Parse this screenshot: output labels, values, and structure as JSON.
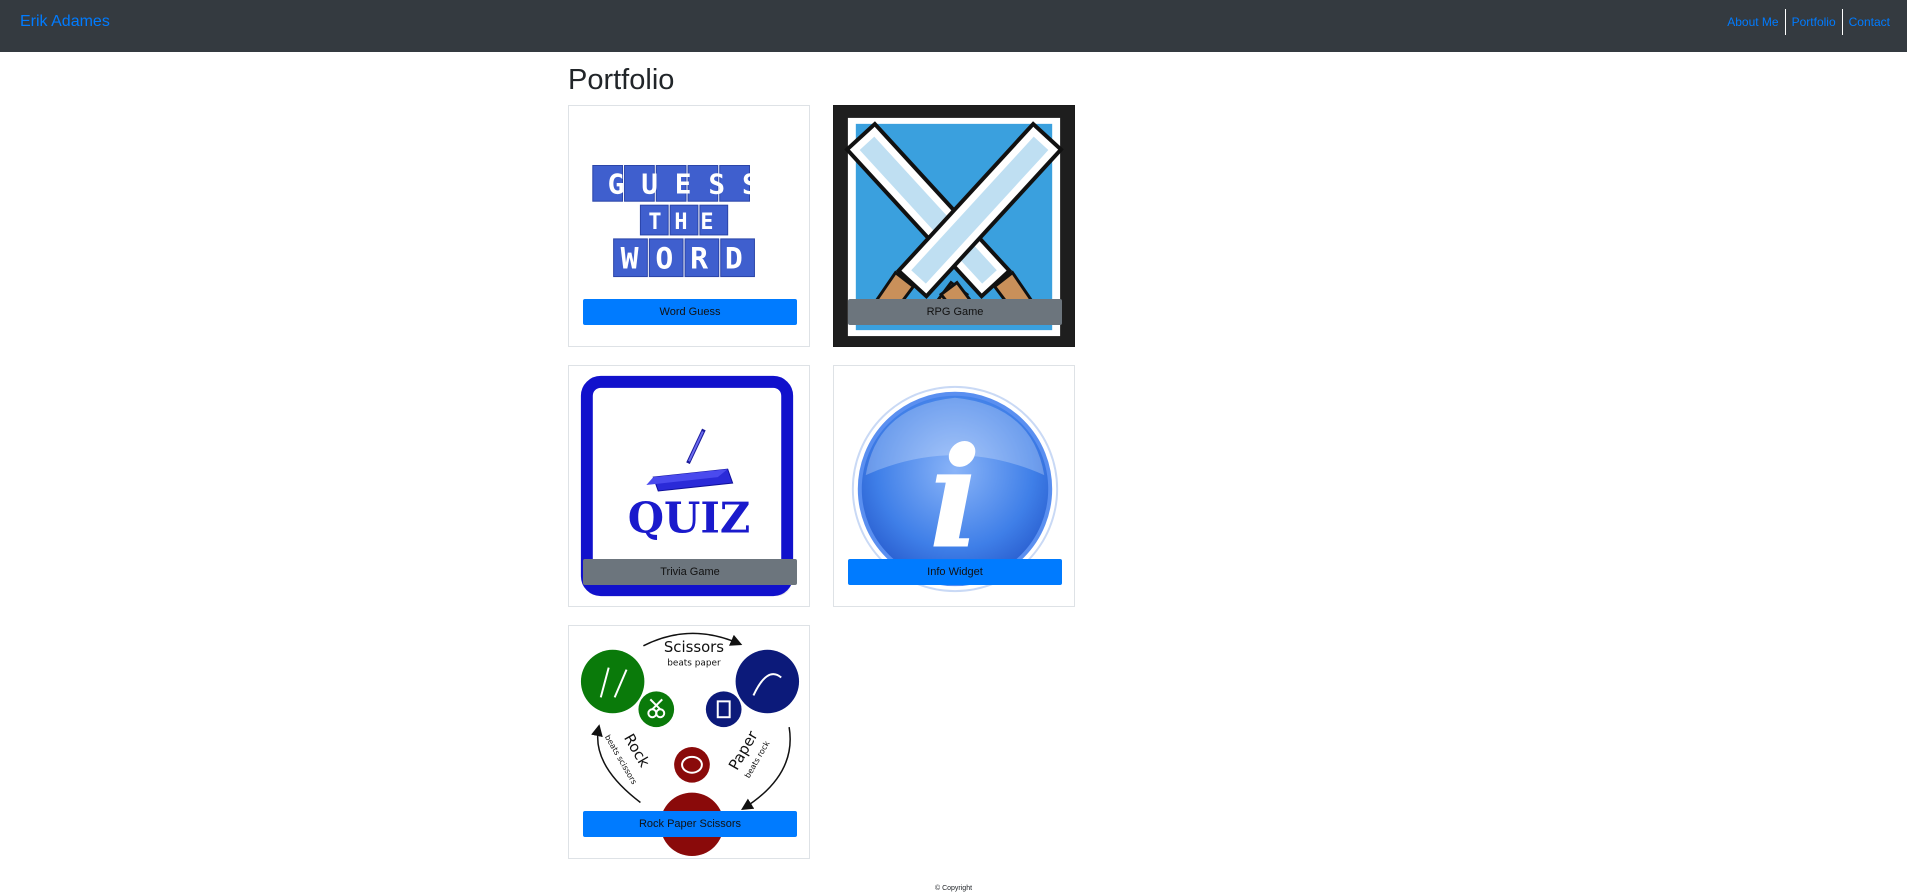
{
  "navbar": {
    "brand": "Erik Adames",
    "links": [
      "About Me",
      "Portfolio",
      "Contact"
    ]
  },
  "page": {
    "title": "Portfolio"
  },
  "cards": [
    {
      "label": "Word Guess",
      "image_text": [
        "GUESS",
        "THE",
        "WORD"
      ],
      "button_color": "#007bff"
    },
    {
      "label": "RPG Game",
      "button_color": "#6c757d"
    },
    {
      "label": "Trivia Game",
      "image_text": "QUIZ",
      "button_color": "#6c757d"
    },
    {
      "label": "Info Widget",
      "image_text": "i",
      "button_color": "#007bff"
    },
    {
      "label": "Rock Paper Scissors",
      "image_text": {
        "scissors": "Scissors",
        "scissors_sub": "beats paper",
        "rock": "Rock",
        "rock_sub": "beats scissors",
        "paper": "Paper",
        "paper_sub": "beats rock"
      },
      "button_color": "#007bff"
    }
  ],
  "footer": {
    "text": "© Copyright"
  },
  "colors": {
    "navbar": "#343a40",
    "link": "#007bff",
    "primary": "#007bff",
    "secondary": "#6c757d"
  }
}
